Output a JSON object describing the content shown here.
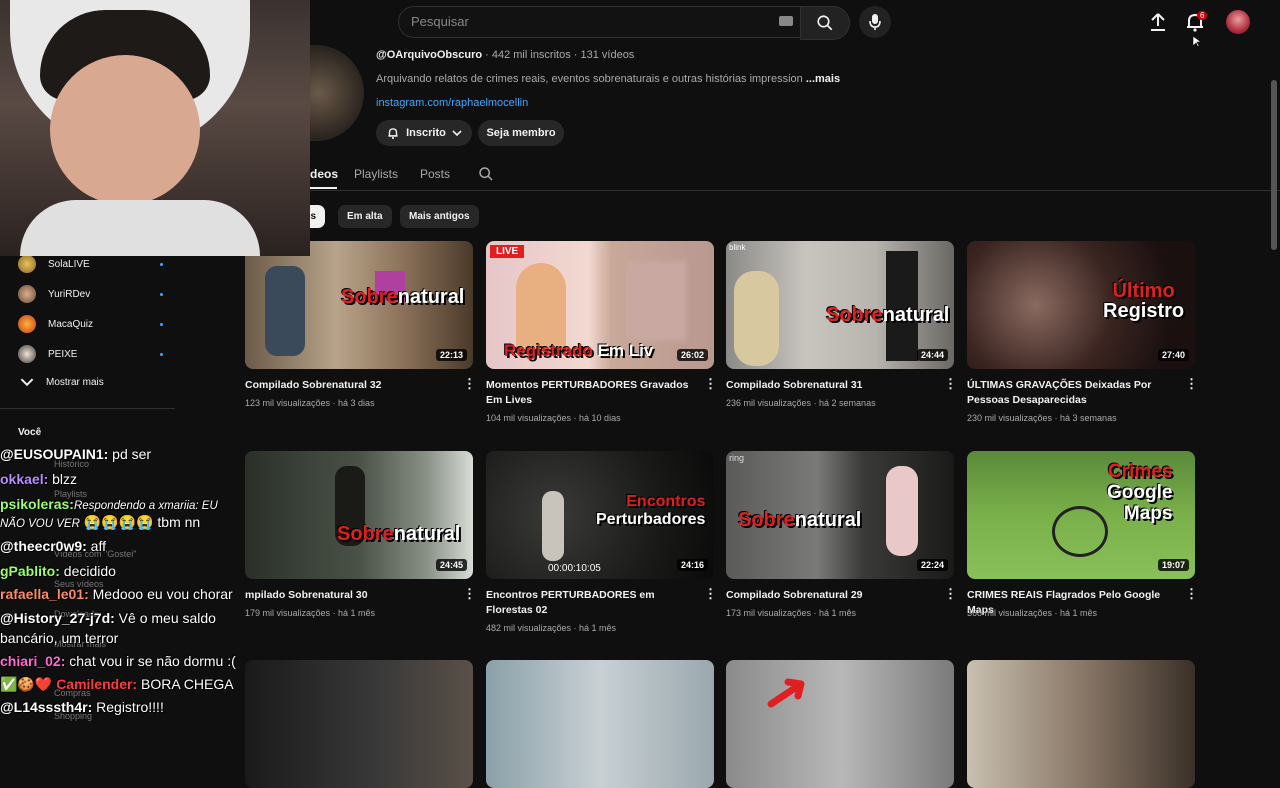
{
  "header": {
    "search_placeholder": "Pesquisar",
    "notification_count": "6"
  },
  "channel": {
    "handle": "@OArquivoObscuro",
    "stats": " · 442 mil inscritos · 131 vídeos",
    "description": "Arquivando relatos de crimes reais, eventos sobrenaturais e outras histórias impression",
    "more_label": "...mais",
    "link": "instagram.com/raphaelmocellin",
    "subscribed_label": "Inscrito",
    "member_label": "Seja membro"
  },
  "tabs": [
    "deos",
    "Playlists",
    "Posts"
  ],
  "chips": [
    "es",
    "Em alta",
    "Mais antigos"
  ],
  "sidebar": {
    "items": [
      {
        "label": "SolaLIVE"
      },
      {
        "label": "YuriRDev"
      },
      {
        "label": "MacaQuiz"
      },
      {
        "label": "PEIXE"
      }
    ],
    "show_more": "Mostrar mais",
    "ghost_items": [
      "Você",
      "Histórico",
      "Playlists",
      "Vídeos com \"Gostei\"",
      "Seus vídeos",
      "Downloads",
      "Mostrar mais",
      "Compras",
      "Shopping"
    ]
  },
  "videos": [
    {
      "title": "Compilado Sobrenatural 32",
      "meta": "123 mil visualizações · há 3 dias",
      "duration": "22:13",
      "overlay": "Sobrenatural"
    },
    {
      "title": "Momentos PERTURBADORES Gravados Em Lives",
      "meta": "104 mil visualizações · há 10 dias",
      "duration": "26:02",
      "overlay": "Registrado Em Liv",
      "tag": "LIVE"
    },
    {
      "title": "Compilado Sobrenatural 31",
      "meta": "236 mil visualizações · há 2 semanas",
      "duration": "24:44",
      "overlay": "Sobrenatural",
      "tag": "blink"
    },
    {
      "title": "ÚLTIMAS GRAVAÇÕES Deixadas Por Pessoas Desaparecidas",
      "meta": "230 mil visualizações · há 3 semanas",
      "duration": "27:40",
      "overlay": "Último Registro"
    },
    {
      "title": "mpilado Sobrenatural 30",
      "meta": "179 mil visualizações · há 1 mês",
      "duration": "24:45",
      "overlay": "Sobrenatural"
    },
    {
      "title": "Encontros PERTURBADORES em Florestas 02",
      "meta": "482 mil visualizações · há 1 mês",
      "duration": "24:16",
      "overlay": "Encontros Perturbadores",
      "timestamp": "00:00:10:05"
    },
    {
      "title": "Compilado Sobrenatural 29",
      "meta": "173 mil visualizações · há 1 mês",
      "duration": "22:24",
      "overlay": "Sobrenatural",
      "tag": "ring"
    },
    {
      "title": "CRIMES REAIS Flagrados Pelo Google Maps",
      "meta": "368 mil visualizações · há 1 mês",
      "duration": "19:07",
      "overlay": "Crimes Google Maps"
    }
  ],
  "chat": [
    {
      "user": "@EUSOUPAIN1:",
      "msg": " pd ser",
      "color": "#ffffff"
    },
    {
      "user": "okkael:",
      "msg": " blzz",
      "color": "#b58cff"
    },
    {
      "user": "psikoleras:",
      "msg": "Respondendo a xmariia: EU",
      "color": "#9aff6a",
      "italic": true
    },
    {
      "user": "",
      "msg": "NÃO VOU VER",
      "tail": " tbm nn",
      "color": "#ffffff"
    },
    {
      "user": "@theecr0w9:",
      "msg": " aff",
      "color": "#ffffff"
    },
    {
      "user": "gPablito:",
      "msg": " decidido",
      "color": "#9aff6a"
    },
    {
      "user": "rafaella_le01:",
      "msg": " Medooo eu vou chorar",
      "color": "#ff8a65"
    },
    {
      "user": "@History_27-j7d:",
      "msg": " Vê o meu saldo",
      "color": "#ffffff"
    },
    {
      "user": "",
      "msg": "bancário, um terror",
      "color": "#ffffff"
    },
    {
      "user": "chiari_02:",
      "msg": " chat vou ir se não dormu :(",
      "color": "#ff6bd6"
    },
    {
      "user": "Camilender:",
      "msg": " BORA CHEGA",
      "color": "#ff3b3b"
    },
    {
      "user": "@L14sssth4r:",
      "msg": " Registro!!!!",
      "color": "#ffffff"
    }
  ]
}
